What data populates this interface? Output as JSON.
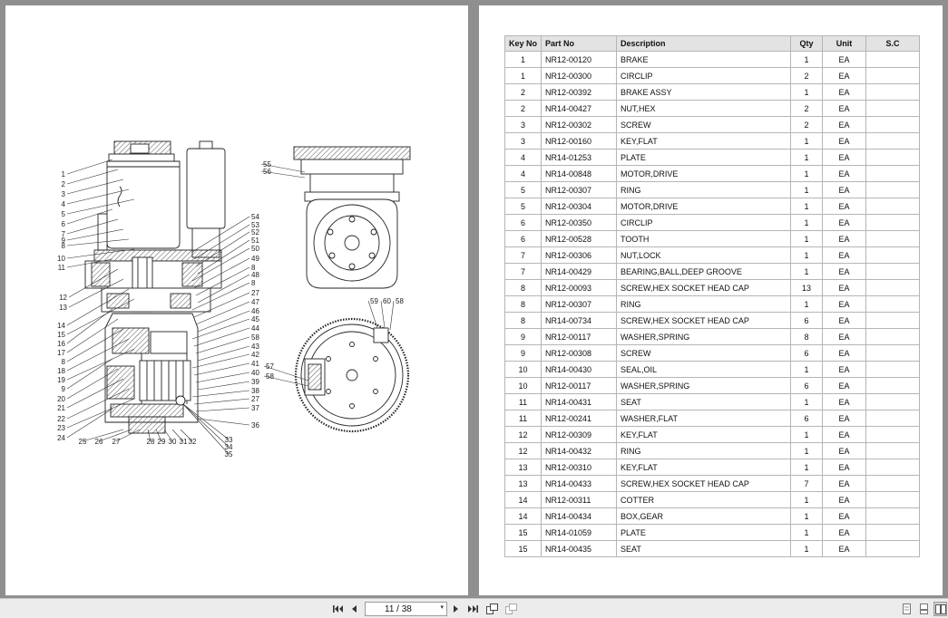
{
  "diagram": {
    "callouts_left": [
      "1",
      "2",
      "3",
      "4",
      "5",
      "6",
      "7",
      "9",
      "8",
      "10",
      "11",
      "12",
      "13",
      "14",
      "15",
      "16",
      "17",
      "8",
      "18",
      "19",
      "9",
      "20",
      "21",
      "22",
      "23",
      "24"
    ],
    "callouts_right": [
      "54",
      "53",
      "52",
      "51",
      "50",
      "49",
      "8",
      "48",
      "8",
      "27",
      "47",
      "46",
      "45",
      "44",
      "58",
      "43",
      "42",
      "41",
      "40",
      "39",
      "38",
      "27",
      "37",
      "36"
    ],
    "callouts_bottom": [
      "25",
      "26",
      "27",
      "28",
      "29",
      "30",
      "31",
      "32",
      "33",
      "34",
      "35"
    ],
    "callouts_top_view": [
      "55",
      "56"
    ],
    "callouts_bottom_view": [
      "59",
      "60",
      "58",
      "57",
      "58"
    ]
  },
  "table": {
    "headers": [
      "Key No",
      "Part No",
      "Description",
      "Qty",
      "Unit",
      "S.C"
    ],
    "rows": [
      [
        "1",
        "NR12-00120",
        "BRAKE",
        "1",
        "EA",
        ""
      ],
      [
        "1",
        "NR12-00300",
        "CIRCLIP",
        "2",
        "EA",
        ""
      ],
      [
        "2",
        "NR12-00392",
        "BRAKE ASSY",
        "1",
        "EA",
        ""
      ],
      [
        "2",
        "NR14-00427",
        "NUT,HEX",
        "2",
        "EA",
        ""
      ],
      [
        "3",
        "NR12-00302",
        "SCREW",
        "2",
        "EA",
        ""
      ],
      [
        "3",
        "NR12-00160",
        "KEY,FLAT",
        "1",
        "EA",
        ""
      ],
      [
        "4",
        "NR14-01253",
        "PLATE",
        "1",
        "EA",
        ""
      ],
      [
        "4",
        "NR14-00848",
        "MOTOR,DRIVE",
        "1",
        "EA",
        ""
      ],
      [
        "5",
        "NR12-00307",
        "RING",
        "1",
        "EA",
        ""
      ],
      [
        "5",
        "NR12-00304",
        "MOTOR,DRIVE",
        "1",
        "EA",
        ""
      ],
      [
        "6",
        "NR12-00350",
        "CIRCLIP",
        "1",
        "EA",
        ""
      ],
      [
        "6",
        "NR12-00528",
        "TOOTH",
        "1",
        "EA",
        ""
      ],
      [
        "7",
        "NR12-00306",
        "NUT,LOCK",
        "1",
        "EA",
        ""
      ],
      [
        "7",
        "NR14-00429",
        "BEARING,BALL,DEEP GROOVE",
        "1",
        "EA",
        ""
      ],
      [
        "8",
        "NR12-00093",
        "SCREW,HEX SOCKET HEAD CAP",
        "13",
        "EA",
        ""
      ],
      [
        "8",
        "NR12-00307",
        "RING",
        "1",
        "EA",
        ""
      ],
      [
        "8",
        "NR14-00734",
        "SCREW,HEX SOCKET HEAD CAP",
        "6",
        "EA",
        ""
      ],
      [
        "9",
        "NR12-00117",
        "WASHER,SPRING",
        "8",
        "EA",
        ""
      ],
      [
        "9",
        "NR12-00308",
        "SCREW",
        "6",
        "EA",
        ""
      ],
      [
        "10",
        "NR14-00430",
        "SEAL,OIL",
        "1",
        "EA",
        ""
      ],
      [
        "10",
        "NR12-00117",
        "WASHER,SPRING",
        "6",
        "EA",
        ""
      ],
      [
        "11",
        "NR14-00431",
        "SEAT",
        "1",
        "EA",
        ""
      ],
      [
        "11",
        "NR12-00241",
        "WASHER,FLAT",
        "6",
        "EA",
        ""
      ],
      [
        "12",
        "NR12-00309",
        "KEY,FLAT",
        "1",
        "EA",
        ""
      ],
      [
        "12",
        "NR14-00432",
        "RING",
        "1",
        "EA",
        ""
      ],
      [
        "13",
        "NR12-00310",
        "KEY,FLAT",
        "1",
        "EA",
        ""
      ],
      [
        "13",
        "NR14-00433",
        "SCREW,HEX SOCKET HEAD CAP",
        "7",
        "EA",
        ""
      ],
      [
        "14",
        "NR12-00311",
        "COTTER",
        "1",
        "EA",
        ""
      ],
      [
        "14",
        "NR14-00434",
        "BOX,GEAR",
        "1",
        "EA",
        ""
      ],
      [
        "15",
        "NR14-01059",
        "PLATE",
        "1",
        "EA",
        ""
      ],
      [
        "15",
        "NR14-00435",
        "SEAT",
        "1",
        "EA",
        ""
      ]
    ]
  },
  "toolbar": {
    "page_indicator": "11 / 38",
    "buttons": [
      "first-page-icon",
      "prev-page-icon",
      "next-page-icon",
      "last-page-icon",
      "fit-page-icon",
      "fit-width-icon",
      "single-page-icon",
      "continuous-icon",
      "facing-icon"
    ]
  }
}
